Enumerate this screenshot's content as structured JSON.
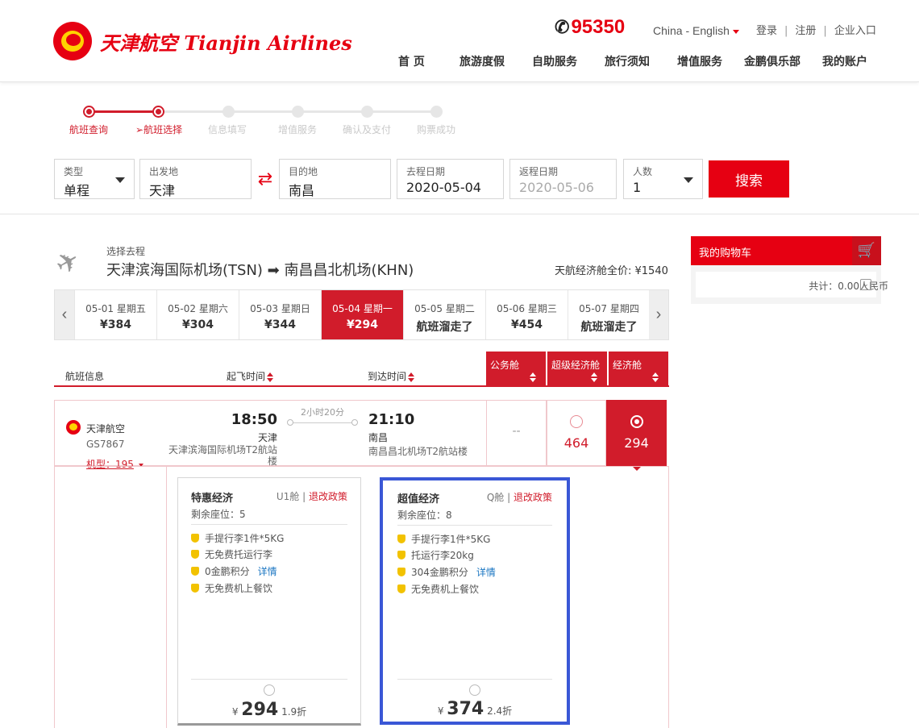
{
  "header": {
    "logo_text": "天津航空 Tianjin Airlines",
    "hotline_icon": "phone-icon",
    "hotline": "95350",
    "language": "China - English",
    "top_links": [
      "登录",
      "注册",
      "企业入口"
    ],
    "nav": [
      "首 页",
      "旅游度假",
      "自助服务",
      "旅行须知",
      "增值服务",
      "金鹏俱乐部",
      "我的账户"
    ]
  },
  "steps": {
    "labels": [
      "航班查询",
      "航班选择",
      "信息填写",
      "增值服务",
      "确认及支付",
      "购票成功"
    ],
    "current_marker": "➢"
  },
  "search": {
    "type_label": "类型",
    "type_value": "单程",
    "from_label": "出发地",
    "from_value": "天津",
    "to_label": "目的地",
    "to_value": "南昌",
    "depart_label": "去程日期",
    "depart_value": "2020-05-04",
    "return_label": "返程日期",
    "return_value": "2020-05-06",
    "pax_label": "人数",
    "pax_value": "1",
    "button": "搜索",
    "accent": "#e60012"
  },
  "route": {
    "sub": "选择去程",
    "main": "天津滨海国际机场(TSN) ➡ 南昌昌北机场(KHN)",
    "full_price": "天航经济舱全价: ¥1540"
  },
  "dates": [
    {
      "date": "05-01 星期五",
      "price": "¥384"
    },
    {
      "date": "05-02 星期六",
      "price": "¥304"
    },
    {
      "date": "05-03 星期日",
      "price": "¥344"
    },
    {
      "date": "05-04 星期一",
      "price": "¥294"
    },
    {
      "date": "05-05 星期二",
      "price": "航班溜走了"
    },
    {
      "date": "05-06 星期三",
      "price": "¥454"
    },
    {
      "date": "05-07 星期四",
      "price": "航班溜走了"
    }
  ],
  "table_header": {
    "flight_info": "航班信息",
    "depart_time": "起飞时间",
    "arrive_time": "到达时间",
    "cabins": [
      "公务舱",
      "超级经济舱",
      "经济舱"
    ]
  },
  "flight": {
    "airline": "天津航空",
    "number": "GS7867",
    "model": "机型：195",
    "dep_time": "18:50",
    "dep_city": "天津",
    "dep_airport": "天津滨海国际机场T2航站楼",
    "duration": "2小时20分",
    "arr_time": "21:10",
    "arr_city": "南昌",
    "arr_airport": "南昌昌北机场T2航站楼",
    "business": "--",
    "super_economy": "464",
    "economy": "294"
  },
  "fares": [
    {
      "name": "特惠经济",
      "class": "U1舱",
      "policy": "退改政策",
      "seats": "剩余座位：5",
      "features": [
        "手提行李1件*5KG",
        "无免费托运行李",
        "0金鹏积分",
        "无免费机上餐饮"
      ],
      "detail_link": "详情",
      "price": "294",
      "discount": "1.9折"
    },
    {
      "name": "超值经济",
      "class": "Q舱",
      "policy": "退改政策",
      "seats": "剩余座位：8",
      "features": [
        "手提行李1件*5KG",
        "托运行李20kg",
        "304金鹏积分",
        "无免费机上餐饮"
      ],
      "detail_link": "详情",
      "price": "374",
      "discount": "2.4折"
    }
  ],
  "cart": {
    "title": "我的购物车",
    "total": "共计：0.00人民币"
  }
}
